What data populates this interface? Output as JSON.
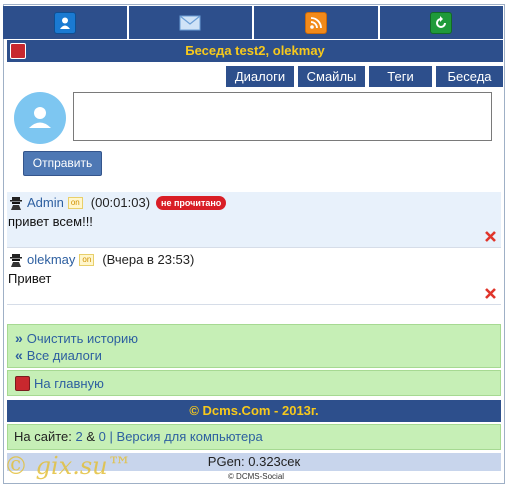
{
  "topnav": {
    "items": [
      {
        "icon": "user-icon"
      },
      {
        "icon": "mail-icon"
      },
      {
        "icon": "rss-icon"
      },
      {
        "icon": "refresh-icon"
      }
    ]
  },
  "header": {
    "title": "Беседа test2, olekmay"
  },
  "tabs": [
    "Диалоги",
    "Смайлы",
    "Теги",
    "Беседа"
  ],
  "compose": {
    "value": "",
    "send_label": "Отправить"
  },
  "messages": [
    {
      "author": "Admin",
      "status": "on",
      "time": "(00:01:03)",
      "badge": "не прочитано",
      "text": "привет всем!!!"
    },
    {
      "author": "olekmay",
      "status": "on",
      "time": "(Вчера в 23:53)",
      "badge": "",
      "text": "Привет"
    }
  ],
  "links": {
    "clear_history": "Очистить историю",
    "all_dialogs": "Все диалоги",
    "home": "На главную"
  },
  "footer": {
    "copyright": "© Dcms.Com - 2013г.",
    "online_prefix": "На сайте:",
    "online_users": "2",
    "online_sep": "&",
    "online_guests": "0",
    "pipe": "|",
    "desktop_version": "Версия для компьютера",
    "pgen": "PGen: 0.323сек",
    "social": "© DCMS-Social"
  },
  "watermark": "© gix.su™",
  "colors": {
    "nav": "#2d4f8c",
    "title": "#f7c91c",
    "green": "#c6efb6",
    "badge": "#d91e26"
  }
}
